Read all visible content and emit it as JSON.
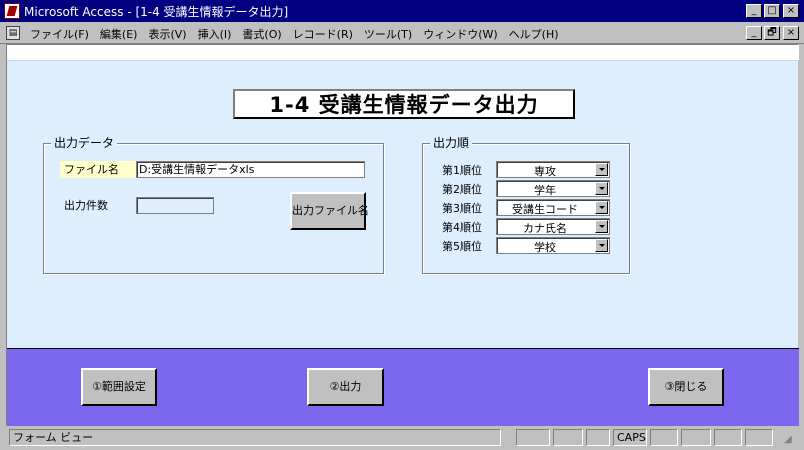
{
  "window": {
    "title": "Microsoft Access - [1-4 受講生情報データ出力]",
    "minimize": "_",
    "maximize": "□",
    "close": "×",
    "restore": "🗗"
  },
  "menu": {
    "items": [
      "ファイル(F)",
      "編集(E)",
      "表示(V)",
      "挿入(I)",
      "書式(O)",
      "レコード(R)",
      "ツール(T)",
      "ウィンドウ(W)",
      "ヘルプ(H)"
    ]
  },
  "form": {
    "title": "1-4  受講生情報データ出力",
    "output_data": {
      "legend": "出力データ",
      "filename_label": "ファイル名",
      "filename_value": "D:受講生情報データxls",
      "count_label": "出力件数",
      "count_value": "",
      "filename_button": "出力ファイル名"
    },
    "output_order": {
      "legend": "出力順",
      "rows": [
        {
          "label": "第1順位",
          "value": "専攻"
        },
        {
          "label": "第2順位",
          "value": "学年"
        },
        {
          "label": "第3順位",
          "value": "受講生コード"
        },
        {
          "label": "第4順位",
          "value": "カナ氏名"
        },
        {
          "label": "第5順位",
          "value": "学校"
        }
      ]
    },
    "buttons": {
      "range": "①範囲設定",
      "output": "②出力",
      "close": "③閉じる"
    }
  },
  "status": {
    "view": "フォーム ビュー",
    "caps": "CAPS"
  },
  "colors": {
    "titlebar": "#000080",
    "form_bg": "#ddeeff",
    "footer": "#7b68ee"
  }
}
